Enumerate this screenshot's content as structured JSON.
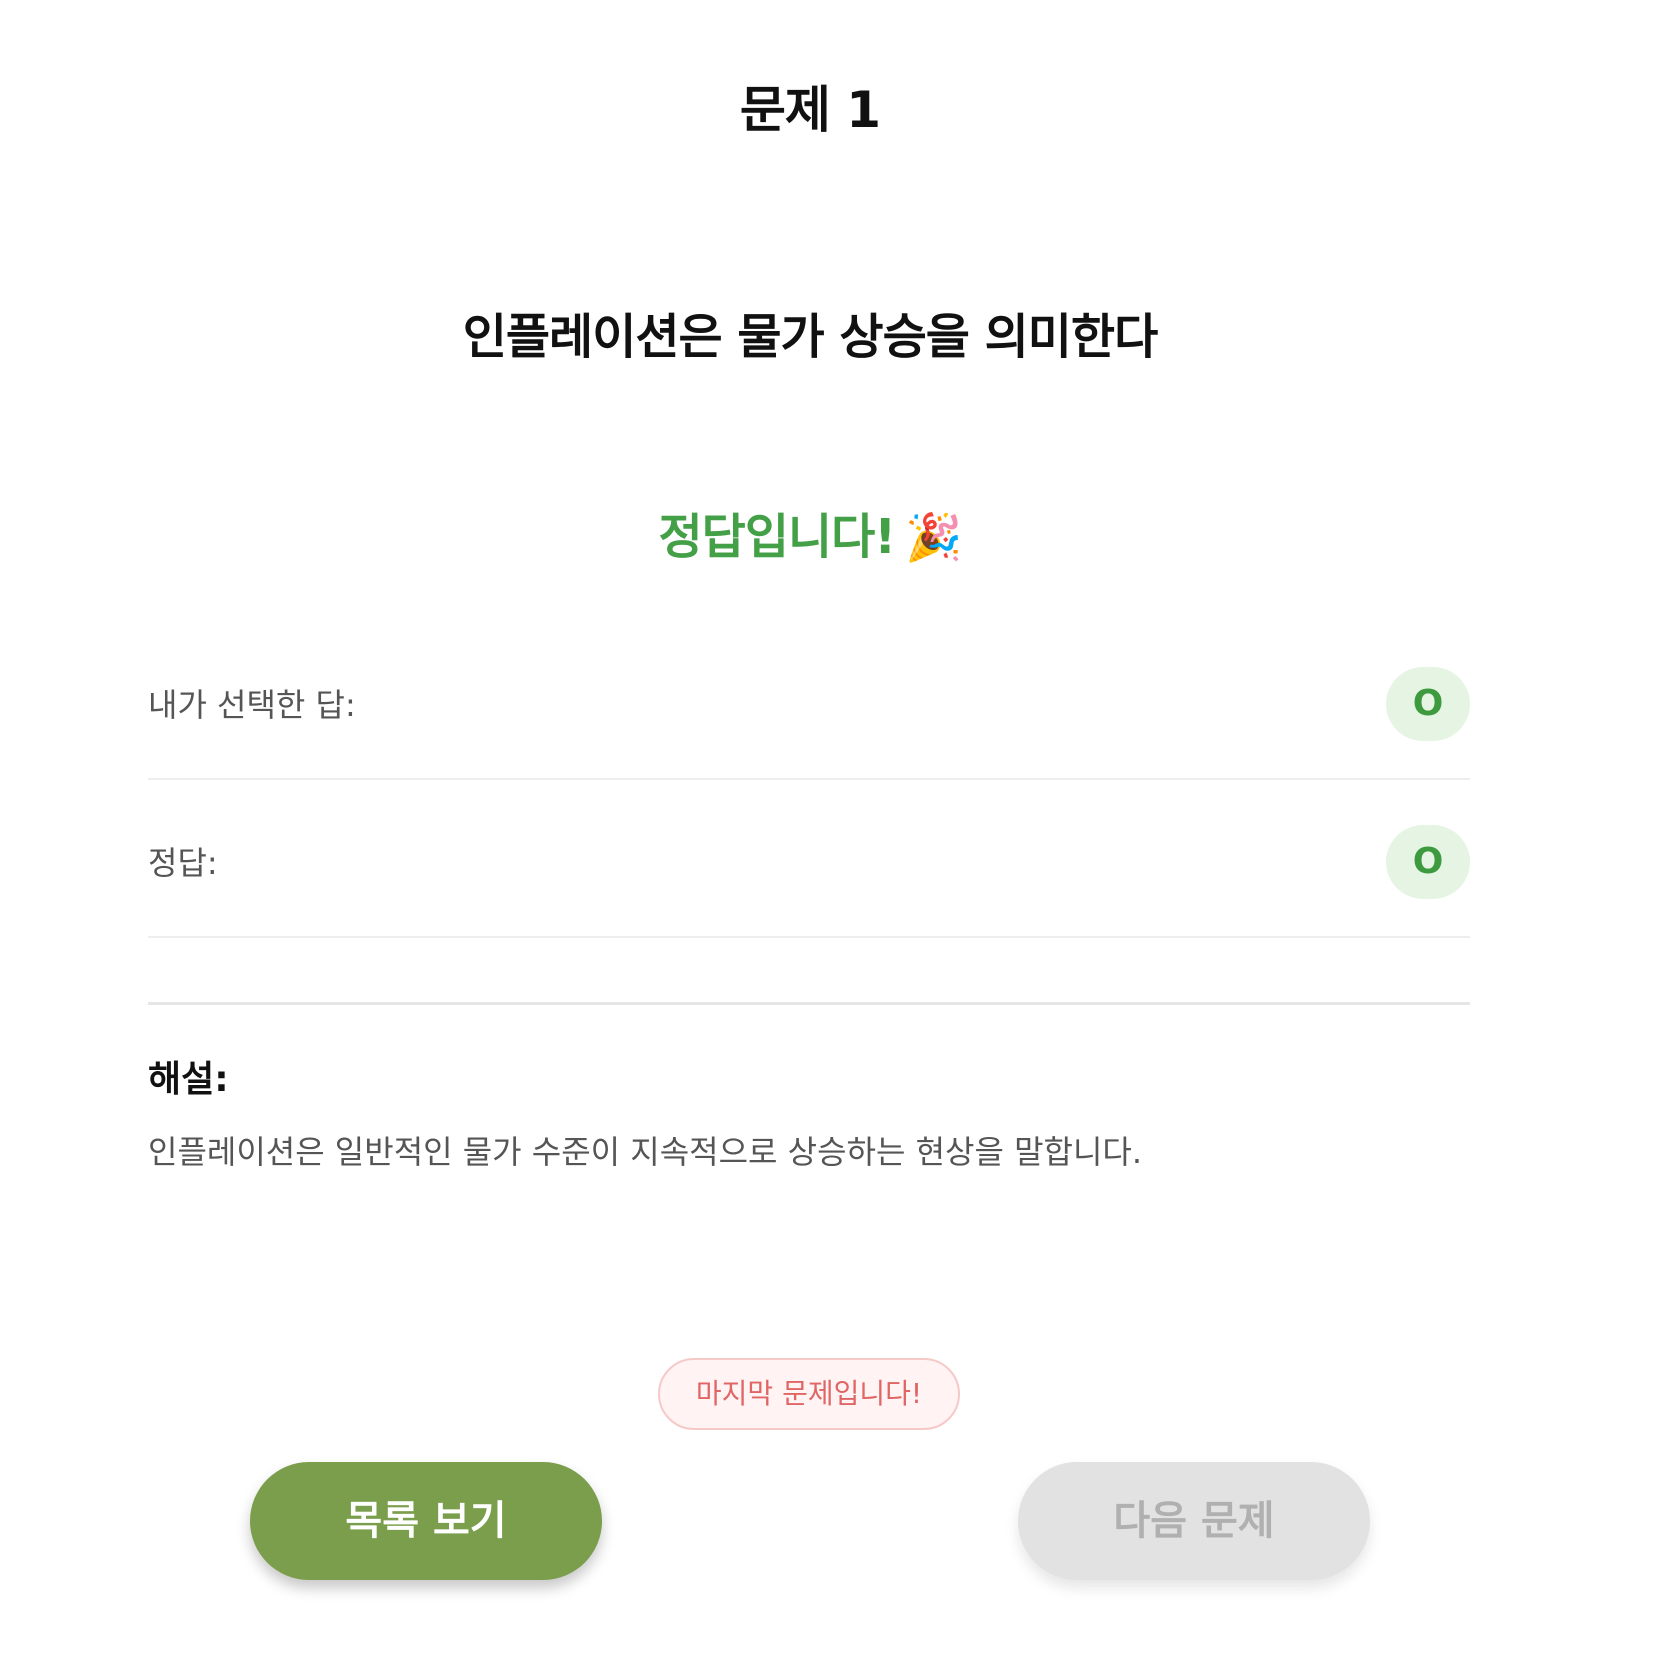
{
  "header": {
    "title": "문제 1"
  },
  "question": {
    "text": "인플레이션은 물가 상승을 의미한다"
  },
  "result": {
    "message": "정답입니다!",
    "icon": "🎉",
    "color": "#43a047"
  },
  "answers": {
    "selected_label": "내가 선택한 답:",
    "selected_value": "O",
    "correct_label": "정답:",
    "correct_value": "O"
  },
  "explanation": {
    "title": "해설:",
    "text": "인플레이션은 일반적인 물가 수준이 지속적으로 상승하는 현상을 말합니다."
  },
  "notice": {
    "last_question": "마지막 문제입니다!"
  },
  "buttons": {
    "list_label": "목록 보기",
    "next_label": "다음 문제"
  },
  "colors": {
    "primary_button": "#7a9e4b",
    "disabled_button": "#e2e2e2",
    "badge_bg": "#e6f4e4",
    "badge_text": "#3d9a3f",
    "notice_text": "#e06666"
  }
}
